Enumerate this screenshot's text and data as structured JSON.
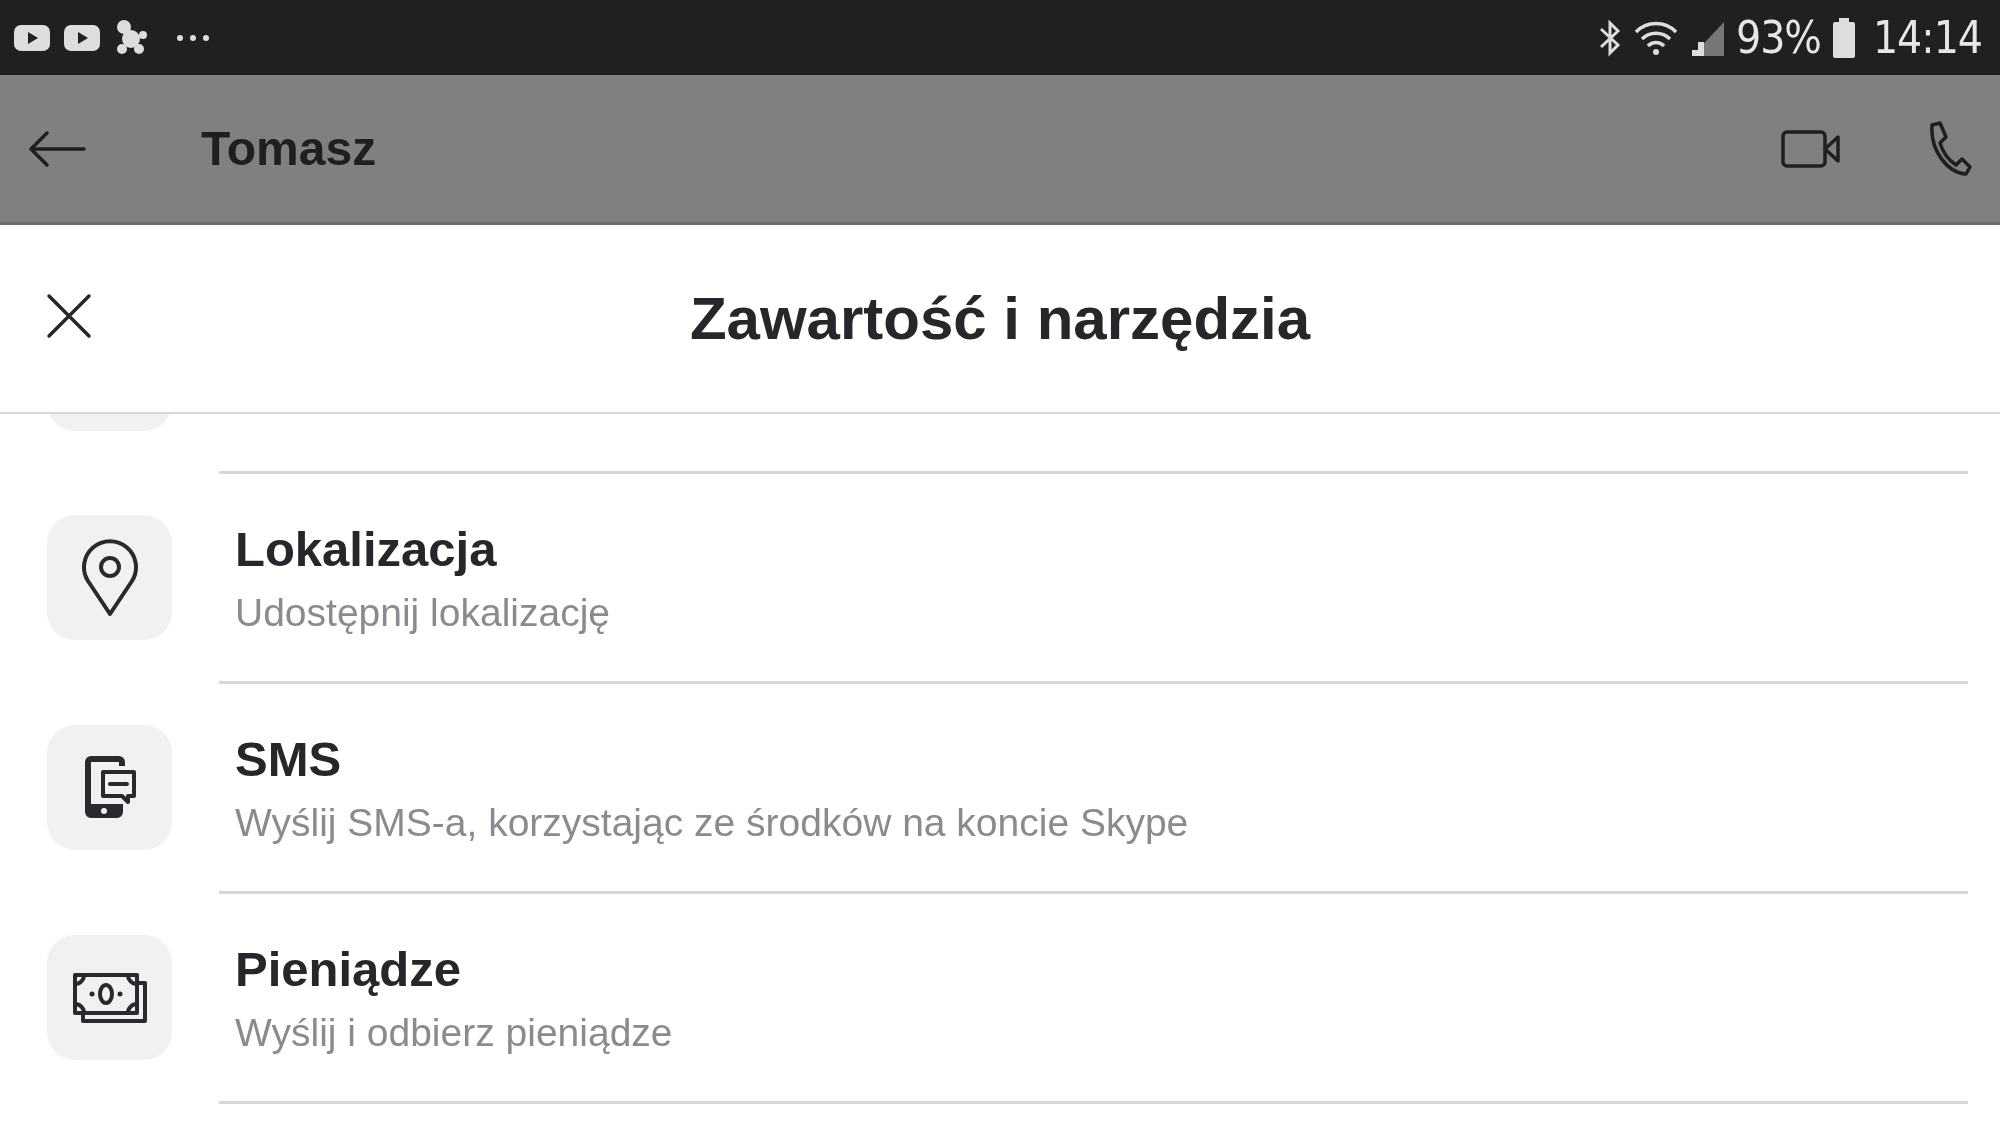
{
  "status_bar": {
    "battery": "93%",
    "time": "14:14"
  },
  "app_bar": {
    "title": "Tomasz"
  },
  "sheet": {
    "title": "Zawartość i narzędzia",
    "items": [
      {
        "kind": "location",
        "title": "Lokalizacja",
        "subtitle": "Udostępnij lokalizację"
      },
      {
        "kind": "sms",
        "title": "SMS",
        "subtitle": "Wyślij SMS-a, korzystając ze środków na koncie Skype"
      },
      {
        "kind": "money",
        "title": "Pieniądze",
        "subtitle": "Wyślij i odbierz pieniądze"
      }
    ]
  }
}
